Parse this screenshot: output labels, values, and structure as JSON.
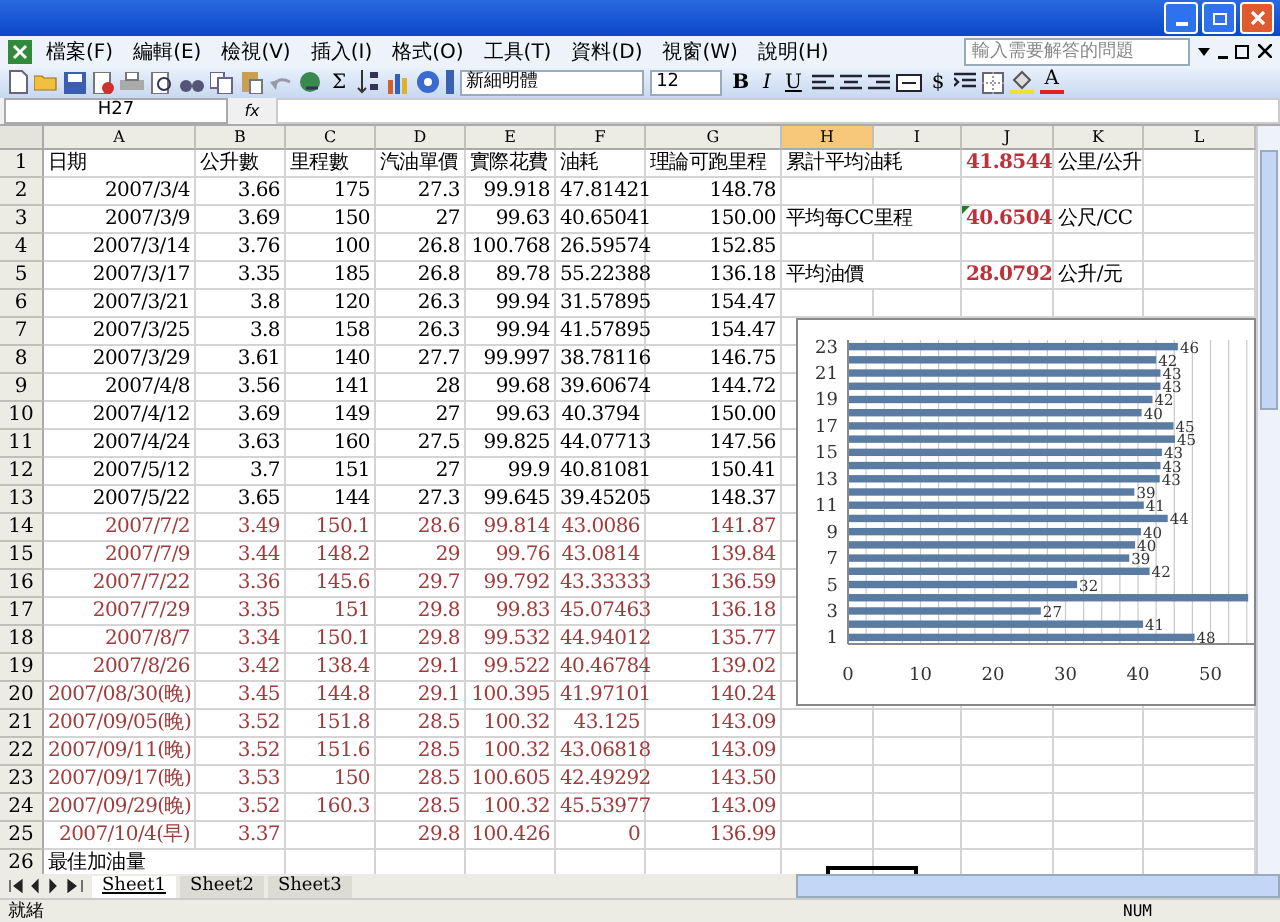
{
  "menu": [
    "檔案(F)",
    "編輯(E)",
    "檢視(V)",
    "插入(I)",
    "格式(O)",
    "工具(T)",
    "資料(D)",
    "視窗(W)",
    "說明(H)"
  ],
  "help_search": {
    "placeholder": "輸入需要解答的問題"
  },
  "toolbar": {
    "sum": "Σ",
    "font": "新細明體",
    "size": "12",
    "bold": "B",
    "italic": "I",
    "underline": "U",
    "currency": "$",
    "font_color": "A"
  },
  "formula_bar": {
    "name_box": "H27",
    "fx": "fx"
  },
  "columns": [
    {
      "label": "A",
      "selected": false
    },
    {
      "label": "B",
      "selected": false
    },
    {
      "label": "C",
      "selected": false
    },
    {
      "label": "D",
      "selected": false
    },
    {
      "label": "E",
      "selected": false
    },
    {
      "label": "F",
      "selected": false
    },
    {
      "label": "G",
      "selected": false
    },
    {
      "label": "H",
      "selected": true
    },
    {
      "label": "I",
      "selected": false
    },
    {
      "label": "J",
      "selected": false
    },
    {
      "label": "K",
      "selected": false
    },
    {
      "label": "L",
      "selected": false
    }
  ],
  "rows": [
    {
      "number": "1",
      "kind": "header",
      "color": "#000000",
      "cells": [
        "日期",
        "公升數",
        "里程數",
        "汽油單價",
        "實際花費",
        "油耗",
        "理論可跑里程"
      ]
    },
    {
      "number": "2",
      "kind": "data",
      "color": "#000000",
      "cells": [
        "2007/3/4",
        "3.66",
        "175",
        "27.3",
        "99.918",
        "47.81421",
        "148.78"
      ]
    },
    {
      "number": "3",
      "kind": "data",
      "color": "#000000",
      "cells": [
        "2007/3/9",
        "3.69",
        "150",
        "27",
        "99.63",
        "40.65041",
        "150.00"
      ]
    },
    {
      "number": "4",
      "kind": "data",
      "color": "#000000",
      "cells": [
        "2007/3/14",
        "3.76",
        "100",
        "26.8",
        "100.768",
        "26.59574",
        "152.85"
      ]
    },
    {
      "number": "5",
      "kind": "data",
      "color": "#000000",
      "cells": [
        "2007/3/17",
        "3.35",
        "185",
        "26.8",
        "89.78",
        "55.22388",
        "136.18"
      ]
    },
    {
      "number": "6",
      "kind": "data",
      "color": "#000000",
      "cells": [
        "2007/3/21",
        "3.8",
        "120",
        "26.3",
        "99.94",
        "31.57895",
        "154.47"
      ]
    },
    {
      "number": "7",
      "kind": "data",
      "color": "#000000",
      "cells": [
        "2007/3/25",
        "3.8",
        "158",
        "26.3",
        "99.94",
        "41.57895",
        "154.47"
      ]
    },
    {
      "number": "8",
      "kind": "data",
      "color": "#000000",
      "cells": [
        "2007/3/29",
        "3.61",
        "140",
        "27.7",
        "99.997",
        "38.78116",
        "146.75"
      ]
    },
    {
      "number": "9",
      "kind": "data",
      "color": "#000000",
      "cells": [
        "2007/4/8",
        "3.56",
        "141",
        "28",
        "99.68",
        "39.60674",
        "144.72"
      ]
    },
    {
      "number": "10",
      "kind": "data",
      "color": "#000000",
      "cells": [
        "2007/4/12",
        "3.69",
        "149",
        "27",
        "99.63",
        "40.3794",
        "150.00"
      ]
    },
    {
      "number": "11",
      "kind": "data",
      "color": "#000000",
      "cells": [
        "2007/4/24",
        "3.63",
        "160",
        "27.5",
        "99.825",
        "44.07713",
        "147.56"
      ]
    },
    {
      "number": "12",
      "kind": "data",
      "color": "#000000",
      "cells": [
        "2007/5/12",
        "3.7",
        "151",
        "27",
        "99.9",
        "40.81081",
        "150.41"
      ]
    },
    {
      "number": "13",
      "kind": "data",
      "color": "#000000",
      "cells": [
        "2007/5/22",
        "3.65",
        "144",
        "27.3",
        "99.645",
        "39.45205",
        "148.37"
      ]
    },
    {
      "number": "14",
      "kind": "data",
      "color": "#a33a3a",
      "cells": [
        "2007/7/2",
        "3.49",
        "150.1",
        "28.6",
        "99.814",
        "43.0086",
        "141.87"
      ]
    },
    {
      "number": "15",
      "kind": "data",
      "color": "#a33a3a",
      "cells": [
        "2007/7/9",
        "3.44",
        "148.2",
        "29",
        "99.76",
        "43.0814",
        "139.84"
      ]
    },
    {
      "number": "16",
      "kind": "data",
      "color": "#a33a3a",
      "cells": [
        "2007/7/22",
        "3.36",
        "145.6",
        "29.7",
        "99.792",
        "43.33333",
        "136.59"
      ]
    },
    {
      "number": "17",
      "kind": "data",
      "color": "#a33a3a",
      "cells": [
        "2007/7/29",
        "3.35",
        "151",
        "29.8",
        "99.83",
        "45.07463",
        "136.18"
      ]
    },
    {
      "number": "18",
      "kind": "data",
      "color": "#a33a3a",
      "cells": [
        "2007/8/7",
        "3.34",
        "150.1",
        "29.8",
        "99.532",
        "44.94012",
        "135.77"
      ]
    },
    {
      "number": "19",
      "kind": "data",
      "color": "#a33a3a",
      "cells": [
        "2007/8/26",
        "3.42",
        "138.4",
        "29.1",
        "99.522",
        "40.46784",
        "139.02"
      ]
    },
    {
      "number": "20",
      "kind": "data",
      "color": "#a33a3a",
      "cells": [
        "2007/08/30(晚)",
        "3.45",
        "144.8",
        "29.1",
        "100.395",
        "41.97101",
        "140.24"
      ]
    },
    {
      "number": "21",
      "kind": "data",
      "color": "#a33a3a",
      "cells": [
        "2007/09/05(晚)",
        "3.52",
        "151.8",
        "28.5",
        "100.32",
        "43.125",
        "143.09"
      ]
    },
    {
      "number": "22",
      "kind": "data",
      "color": "#a33a3a",
      "cells": [
        "2007/09/11(晚)",
        "3.52",
        "151.6",
        "28.5",
        "100.32",
        "43.06818",
        "143.09"
      ]
    },
    {
      "number": "23",
      "kind": "data",
      "color": "#a33a3a",
      "cells": [
        "2007/09/17(晚)",
        "3.53",
        "150",
        "28.5",
        "100.605",
        "42.49292",
        "143.50"
      ]
    },
    {
      "number": "24",
      "kind": "data",
      "color": "#a33a3a",
      "cells": [
        "2007/09/29(晚)",
        "3.52",
        "160.3",
        "28.5",
        "100.32",
        "45.53977",
        "143.09"
      ]
    },
    {
      "number": "25",
      "kind": "data",
      "color": "#a33a3a",
      "cells": [
        "2007/10/4(早)",
        "3.37",
        null,
        "29.8",
        "100.426",
        "0",
        "136.99"
      ]
    },
    {
      "number": "26",
      "kind": "header",
      "color": "#000000",
      "cells": [
        "最佳加油量"
      ]
    }
  ],
  "summary": [
    {
      "label": "累計平均油耗",
      "value": "41.8544",
      "unit": "公里/公升",
      "has_comment": false
    },
    {
      "label": "平均每CC里程",
      "value": "40.6504",
      "unit": "公尺/CC",
      "has_comment": true
    },
    {
      "label": "平均油價",
      "value": "28.0792",
      "unit": "公升/元",
      "has_comment": false
    }
  ],
  "chart": {
    "chart_data": {
      "type": "bar",
      "orientation": "horizontal",
      "grid": true,
      "categories": [
        "23",
        null,
        "21",
        null,
        "19",
        null,
        "17",
        null,
        "15",
        null,
        "13",
        null,
        "11",
        null,
        "9",
        null,
        "7",
        null,
        "5",
        null,
        "3",
        null,
        "1"
      ],
      "series": [
        {
          "color": "#5a7ca3",
          "values": [
            45.5,
            42.5,
            43.1,
            43.1,
            42.0,
            40.5,
            44.9,
            45.1,
            43.3,
            43.1,
            43.0,
            39.5,
            40.8,
            44.1,
            40.4,
            39.6,
            38.8,
            41.6,
            31.6,
            55.2,
            26.6,
            40.7,
            47.8
          ]
        }
      ],
      "value_labels": [
        "46",
        "42",
        "43",
        "43",
        "42",
        "40",
        "45",
        "45",
        "43",
        "43",
        "43",
        "39",
        "41",
        "44",
        "40",
        "40",
        "39",
        "42",
        "32",
        null,
        "27",
        "41",
        "48"
      ],
      "xlim": [
        0,
        56
      ],
      "xticks": [
        0,
        10,
        20,
        30,
        40,
        50
      ]
    }
  },
  "sheet_tabs": [
    {
      "label": "Sheet1",
      "selected": true
    },
    {
      "label": "Sheet2",
      "selected": false
    },
    {
      "label": "Sheet3",
      "selected": false
    }
  ],
  "status_bar": {
    "status": "就緒",
    "num": "NUM"
  }
}
